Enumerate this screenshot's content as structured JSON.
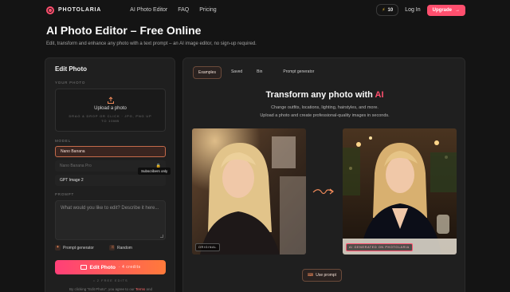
{
  "nav": {
    "brand": "PHOTOLARIA",
    "links": [
      "AI Photo Editor",
      "FAQ",
      "Pricing"
    ],
    "credits": "10",
    "login": "Log In",
    "upgrade": "Upgrade"
  },
  "header": {
    "title": "AI Photo Editor – Free Online",
    "subtitle": "Edit, transform and enhance any photo with a text prompt – an AI image editor, no sign-up required."
  },
  "editor": {
    "title": "Edit Photo",
    "your_photo_label": "YOUR PHOTO",
    "upload_title": "Upload a photo",
    "upload_hint": "DRAG & DROP OR CLICK · JPG, PNG UP TO 10MB",
    "model_label": "MODEL",
    "models": [
      {
        "name": "Nano Banana"
      },
      {
        "name": "Nano Banana Pro"
      },
      {
        "name": "GPT Image 2"
      }
    ],
    "subscribers_tooltip": "Subscribers only",
    "prompt_label": "PROMPT",
    "prompt_placeholder": "What would you like to edit? Describe it here...",
    "prompt_generator": "Prompt generator",
    "random": "Random",
    "edit_button": "Edit Photo",
    "edit_credits": "· 4 credits",
    "free_note": "• 2 FREE EDITS",
    "terms_prefix": "By clicking \"Edit Photo\", you agree to our",
    "terms_link": "Terms",
    "terms_suffix": "and"
  },
  "showcase": {
    "tabs": [
      "Examples",
      "Saved",
      "Bin",
      "Prompt generator"
    ],
    "active_tab": "Examples",
    "title_main": "Transform any photo with",
    "title_ai": "AI",
    "subtitle_line1": "Change outfits, locations, lighting, hairstyles, and more.",
    "subtitle_line2": "Upload a photo and create professional-quality images in seconds.",
    "original_tag": "ORIGINAL",
    "ai_tag": "AI GENERATED ON PHOTOLARIA",
    "use_prompt": "Use prompt"
  },
  "colors": {
    "accent": "#ff4f6e",
    "accent_orange": "#ff7a3a",
    "panel_bg": "#1f1f1f",
    "page_bg": "#141414"
  }
}
